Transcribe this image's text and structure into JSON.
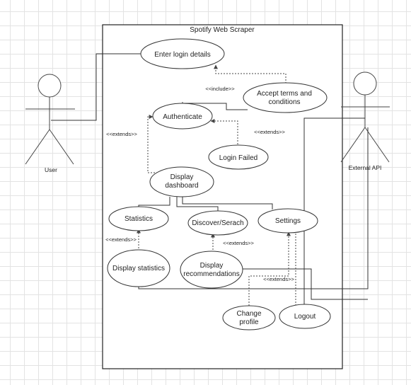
{
  "system": {
    "title": "Spotify Web Scraper"
  },
  "actors": {
    "user": "User",
    "api": "External API"
  },
  "use_cases": {
    "login": "Enter login details",
    "terms_1": "Accept terms and",
    "terms_2": "conditions",
    "auth": "Authenticate",
    "failed": "Login Failed",
    "dashboard_1": "Display",
    "dashboard_2": "dashboard",
    "statistics": "Statistics",
    "discover": "Discover/Serach",
    "settings": "Settings",
    "display_stats": "Display statistics",
    "display_rec_1": "Display",
    "display_rec_2": "recommendations",
    "change_profile_1": "Change",
    "change_profile_2": "profile",
    "logout": "Logout"
  },
  "stereotypes": {
    "include": "<<include>>",
    "extends_dashboard": "<<extends>>",
    "extends_failed": "<<extends>>",
    "extends_stats": "<<extends>>",
    "extends_rec": "<<extends>>",
    "extends_settings": "<<extends>>"
  }
}
